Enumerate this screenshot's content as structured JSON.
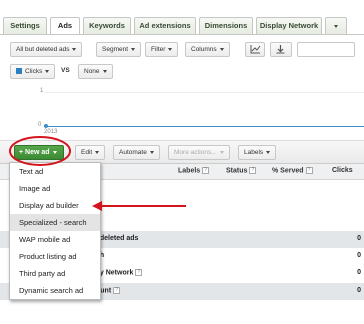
{
  "tabs": [
    "Settings",
    "Ads",
    "Keywords",
    "Ad extensions",
    "Dimensions",
    "Display Network"
  ],
  "filter_bar": {
    "all_but_deleted": "All but deleted ads",
    "segment": "Segment",
    "filter": "Filter",
    "columns": "Columns"
  },
  "chart_controls": {
    "metric": "Clicks",
    "vs": "VS",
    "compare": "None"
  },
  "chart": {
    "y_top": "1",
    "y_bottom": "0",
    "x_label": "2013"
  },
  "toolbar": {
    "new_ad": "+ New ad",
    "edit": "Edit",
    "automate": "Automate",
    "more_actions": "More actions...",
    "labels": "Labels"
  },
  "table": {
    "headers": {
      "labels": "Labels",
      "status": "Status",
      "served": "% Served",
      "clicks": "Clicks"
    },
    "help": "?",
    "rows": [
      {
        "text": "l deleted ads",
        "value": "0"
      },
      {
        "text": "ch",
        "value": "0"
      },
      {
        "text": "ay Network",
        "value": "0"
      },
      {
        "text": "ount",
        "value": "0"
      }
    ]
  },
  "menu": [
    "Text ad",
    "Image ad",
    "Display ad builder",
    "Specialized - search",
    "WAP mobile ad",
    "Product listing ad",
    "Third party ad",
    "Dynamic search ad"
  ],
  "colors": {
    "new_ad_green": "#3d8a34",
    "annotation_red": "#d3141c",
    "chart_line": "#3c8ec9",
    "clicks_swatch": "#2c7fc0"
  }
}
